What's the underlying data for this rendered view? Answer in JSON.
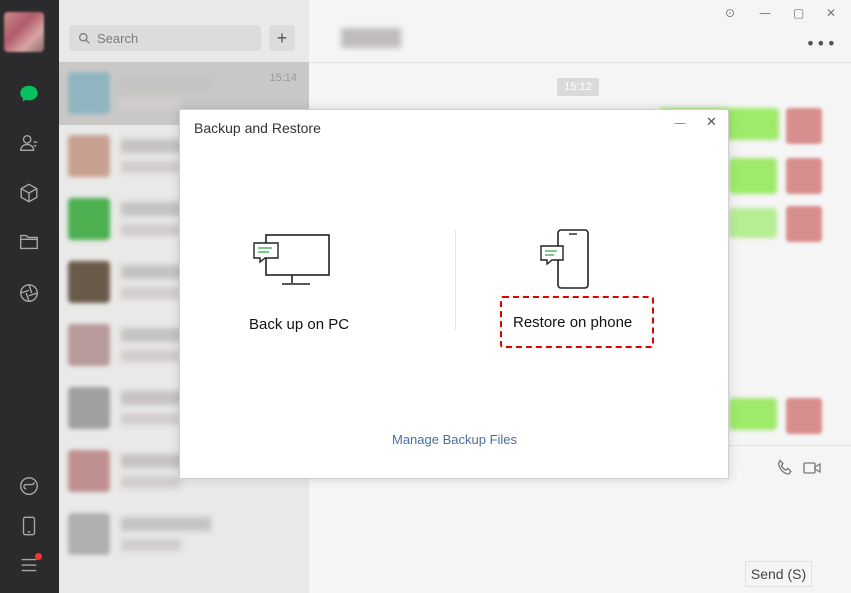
{
  "search": {
    "placeholder": "Search"
  },
  "add_button": {
    "label": "+"
  },
  "chat_list": [
    {
      "time": "15:14",
      "active": true,
      "avatar_color": "#8fb5c0"
    },
    {
      "time": "",
      "active": false,
      "avatar_color": "#c8a090"
    },
    {
      "time": "",
      "active": false,
      "avatar_color": "#4caf50"
    },
    {
      "time": "",
      "active": false,
      "avatar_color": "#6a5a4a"
    },
    {
      "time": "",
      "active": false,
      "avatar_color": "#b89a9a"
    },
    {
      "time": "",
      "active": false,
      "avatar_color": "#a0a0a0"
    },
    {
      "time": "",
      "active": false,
      "avatar_color": "#c09090"
    },
    {
      "time": "",
      "active": false,
      "avatar_color": "#b0b0b0"
    }
  ],
  "conversation": {
    "time_label": "15:12",
    "more_label": "•••",
    "send_label": "Send (S)"
  },
  "window_controls": {
    "pin": "⊙",
    "minimize": "—",
    "maximize": "▢",
    "close": "✕"
  },
  "dialog": {
    "title": "Backup and Restore",
    "minimize": "—",
    "close": "✕",
    "option_pc": "Back up on PC",
    "option_phone": "Restore on phone",
    "manage_link": "Manage Backup Files"
  },
  "colors": {
    "accent_green": "#07c160",
    "bubble_green": "#9eea6a",
    "highlight_red": "#e00000",
    "link_blue": "#4a6f9c",
    "rail_bg": "#2b2b2d"
  },
  "icons": {
    "rail": [
      "chat-icon",
      "contacts-icon",
      "favorites-cube-icon",
      "files-folder-icon",
      "moments-icon",
      "miniprogram-icon",
      "phone-icon",
      "menu-icon"
    ]
  }
}
